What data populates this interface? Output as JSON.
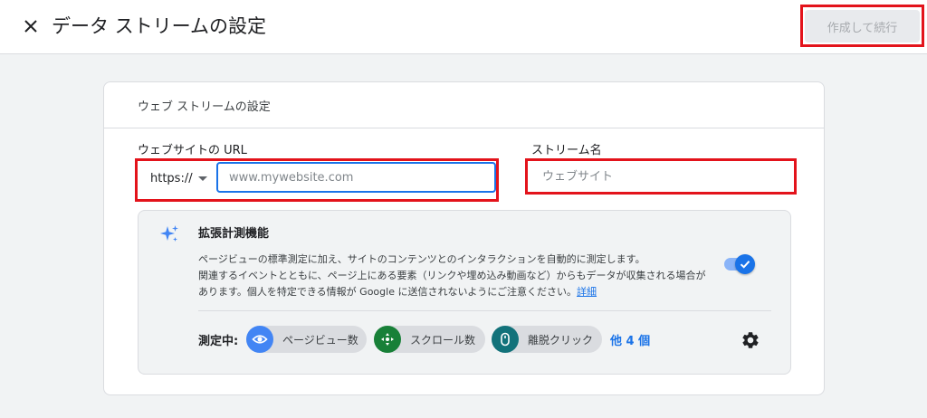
{
  "header": {
    "title": "データ ストリームの設定",
    "create_label": "作成して続行"
  },
  "card": {
    "title": "ウェブ ストリームの設定",
    "url_label": "ウェブサイトの URL",
    "protocol": "https://",
    "url_placeholder": "www.mywebsite.com",
    "name_label": "ストリーム名",
    "name_placeholder": "ウェブサイト"
  },
  "enhanced": {
    "title": "拡張計測機能",
    "desc_line1": "ページビューの標準測定に加え、サイトのコンテンツとのインタラクションを自動的に測定します。",
    "desc_line2": "関連するイベントとともに、ページ上にある要素（リンクや埋め込み動画など）からもデータが収集される場合が",
    "desc_line3": "あります。個人を特定できる情報が Google に送信されないようにご注意ください。",
    "details_link": "詳細",
    "toggle_on": true,
    "measuring_label": "測定中:",
    "chips": [
      {
        "label": "ページビュー数",
        "icon": "eye-icon",
        "color": "#4285f4"
      },
      {
        "label": "スクロール数",
        "icon": "crosshair-icon",
        "color": "#188038"
      },
      {
        "label": "離脱クリック",
        "icon": "mouse-icon",
        "color": "#12727a"
      }
    ],
    "more_label": "他 4 個"
  },
  "colors": {
    "accent": "#1a73e8",
    "highlight": "#e3131b"
  }
}
